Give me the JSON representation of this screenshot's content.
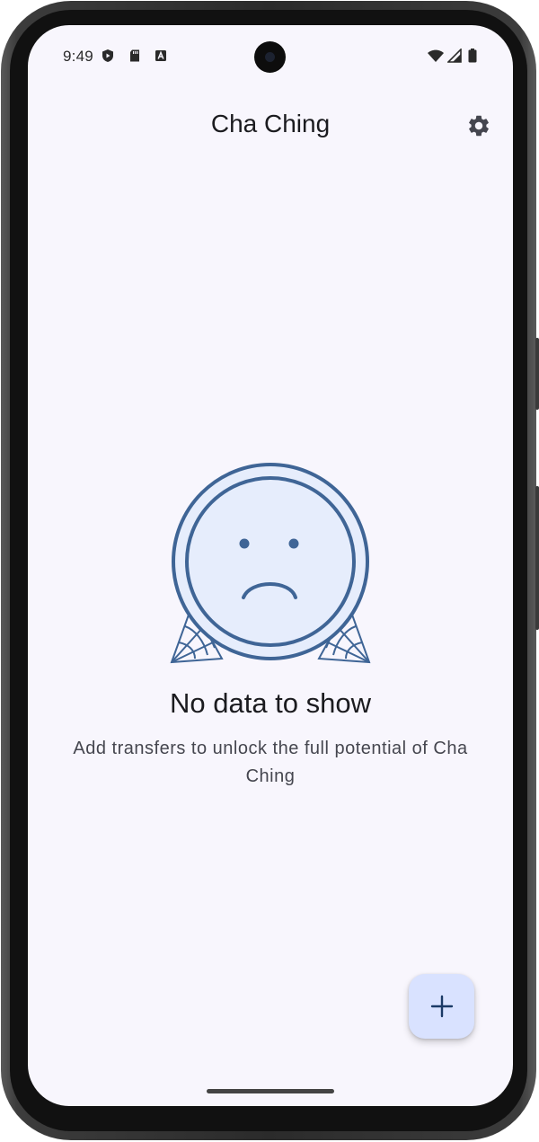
{
  "status_bar": {
    "time": "9:49",
    "left_icons": [
      "shield-play-icon",
      "sd-card-icon",
      "font-a-icon"
    ],
    "right_icons": [
      "wifi-icon",
      "cell-signal-icon",
      "battery-icon"
    ]
  },
  "app_bar": {
    "title": "Cha Ching",
    "settings_icon": "gear-icon"
  },
  "empty_state": {
    "illustration": "sad-coin-cobweb",
    "title": "No data to show",
    "subtitle": "Add transfers to unlock the full potential of Cha Ching"
  },
  "fab": {
    "icon": "plus-icon"
  },
  "colors": {
    "background": "#f8f6fd",
    "accent": "#3f6596",
    "fab": "#d9e2ff",
    "coin_fill": "#e6edfc"
  }
}
